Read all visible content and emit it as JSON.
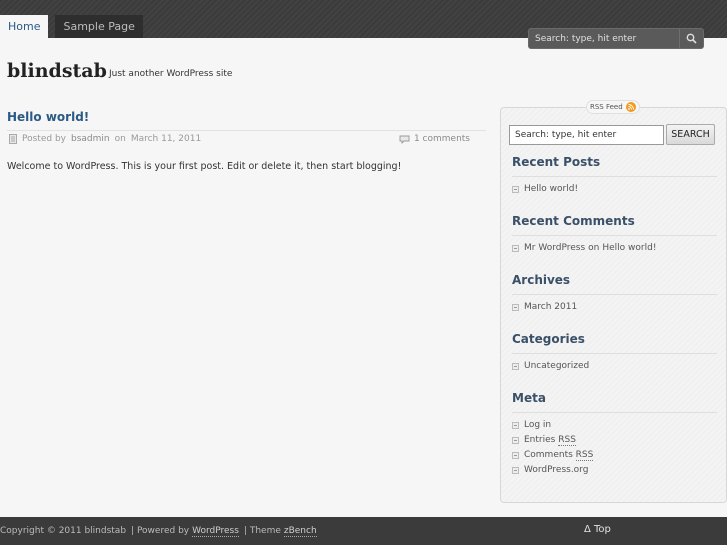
{
  "nav": {
    "home": "Home",
    "sample_page": "Sample Page"
  },
  "top_search": {
    "value": "Search: type, hit enter"
  },
  "header": {
    "title": "blindstab",
    "description": "Just another WordPress site"
  },
  "post": {
    "title": "Hello world!",
    "posted_by": "Posted by",
    "author": "bsadmin",
    "on": "on",
    "date": "March 11, 2011",
    "comments": "1 comments",
    "body": "Welcome to WordPress. This is your first post. Edit or delete it, then start blogging!"
  },
  "sidebar": {
    "rss_label": "RSS Feed",
    "search_value": "Search: type, hit enter",
    "search_button": "SEARCH",
    "recent_posts": {
      "title": "Recent Posts",
      "items": [
        "Hello world!"
      ]
    },
    "recent_comments": {
      "title": "Recent Comments",
      "author": "Mr WordPress",
      "on": "on",
      "post": "Hello world!"
    },
    "archives": {
      "title": "Archives",
      "items": [
        "March 2011"
      ]
    },
    "categories": {
      "title": "Categories",
      "items": [
        "Uncategorized"
      ]
    },
    "meta": {
      "title": "Meta",
      "login": "Log in",
      "entries": "Entries",
      "comments": "Comments",
      "rss": "RSS",
      "wordpress": "WordPress.org"
    }
  },
  "footer": {
    "copyright": "Copyright © 2011 blindstab",
    "powered_by": "| Powered by",
    "wordpress": "WordPress",
    "theme": "| Theme",
    "theme_name": "zBench",
    "top": "Δ Top"
  },
  "colors": {
    "link": "#2b5a85",
    "widget_title": "#3a5068",
    "rss": "#f29a1d"
  }
}
